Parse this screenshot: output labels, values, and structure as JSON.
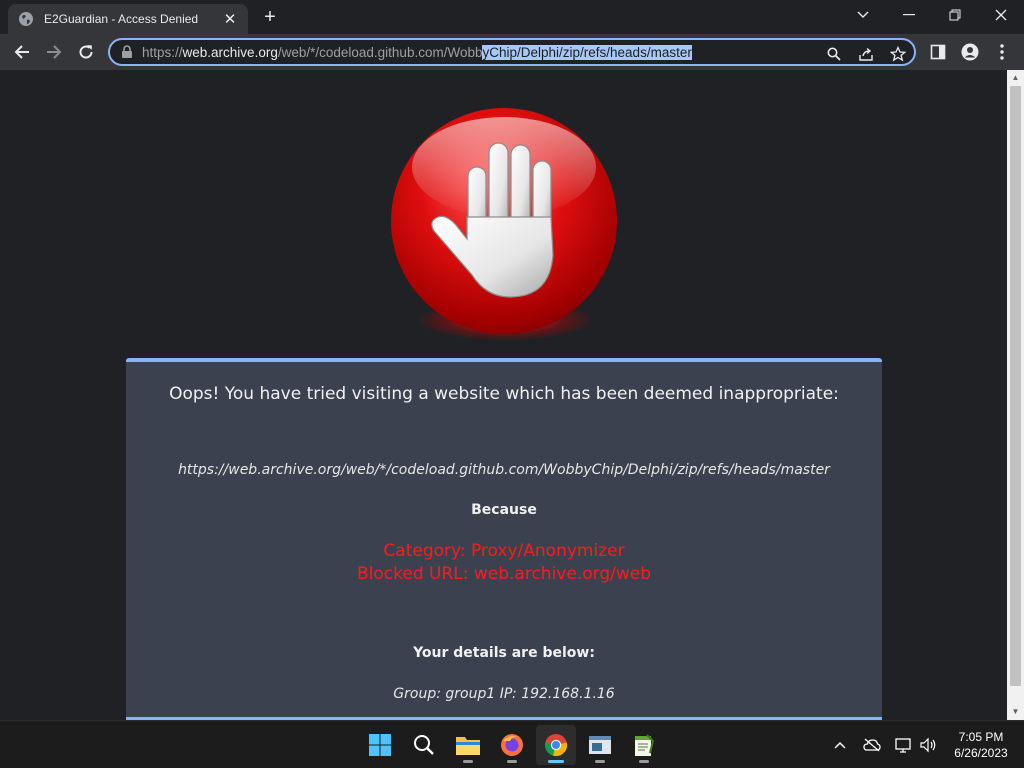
{
  "browser": {
    "tab_title": "E2Guardian - Access Denied",
    "new_tab": "+",
    "address": {
      "scheme": "https://",
      "host": "web.archive.org",
      "path_plain": "/web/*/codeload.github.com/Wobb",
      "path_selected": "yChip/Delphi/zip/refs/heads/master"
    },
    "accent_color": "#8ab4f8"
  },
  "page": {
    "heading": "Oops! You have tried visiting a website which has been deemed inappropriate:",
    "blocked_url": "https://web.archive.org/web/*/codeload.github.com/WobbyChip/Delphi/zip/refs/heads/master",
    "because": "Because",
    "category": "Category: Proxy/Anonymizer",
    "blocked": "Blocked URL: web.archive.org/web",
    "details_heading": "Your details are below:",
    "group_line": "Group: group1   IP: 192.168.1.16",
    "reason_color": "#ff1a1a"
  },
  "taskbar": {
    "apps": [
      "start",
      "search",
      "file-explorer",
      "firefox",
      "chrome",
      "terminal-app",
      "notepad-app"
    ],
    "active_app": "chrome",
    "time": "7:05 PM",
    "date": "6/26/2023"
  }
}
